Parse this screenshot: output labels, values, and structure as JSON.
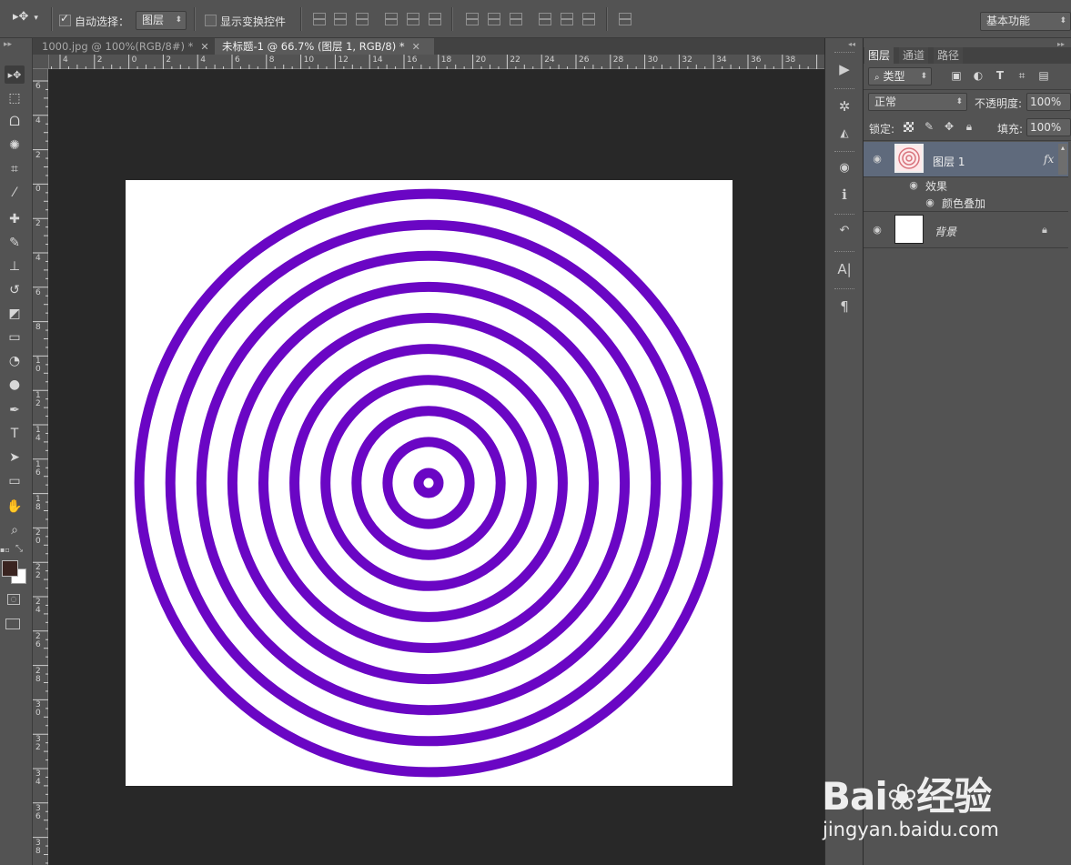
{
  "options_bar": {
    "auto_select_label": "自动选择：",
    "auto_select_checked": true,
    "auto_select_target": "图层",
    "show_transform_label": "显示变换控件",
    "show_transform_checked": false,
    "workspace": "基本功能"
  },
  "document_tabs": [
    {
      "title": "1000.jpg @ 100%(RGB/8#) *",
      "active": false
    },
    {
      "title": "未标题-1 @ 66.7% (图层 1, RGB/8) *",
      "active": true
    }
  ],
  "tools": [
    {
      "icon": "move-tool-icon",
      "glyph": "▸✥"
    },
    {
      "icon": "marquee-tool-icon",
      "glyph": "⬚"
    },
    {
      "icon": "lasso-tool-icon",
      "glyph": "ᗝ"
    },
    {
      "icon": "magic-wand-tool-icon",
      "glyph": "✺"
    },
    {
      "icon": "crop-tool-icon",
      "glyph": "⌗"
    },
    {
      "icon": "eyedropper-tool-icon",
      "glyph": "⁄"
    },
    {
      "icon": "healing-brush-tool-icon",
      "glyph": "✚"
    },
    {
      "icon": "brush-tool-icon",
      "glyph": "✎"
    },
    {
      "icon": "clone-stamp-tool-icon",
      "glyph": "⊥"
    },
    {
      "icon": "history-brush-tool-icon",
      "glyph": "↺"
    },
    {
      "icon": "eraser-tool-icon",
      "glyph": "◩"
    },
    {
      "icon": "gradient-tool-icon",
      "glyph": "▭"
    },
    {
      "icon": "blur-tool-icon",
      "glyph": "◔"
    },
    {
      "icon": "dodge-tool-icon",
      "glyph": "●"
    },
    {
      "icon": "pen-tool-icon",
      "glyph": "✒"
    },
    {
      "icon": "type-tool-icon",
      "glyph": "T"
    },
    {
      "icon": "path-selection-tool-icon",
      "glyph": "➤"
    },
    {
      "icon": "rectangle-tool-icon",
      "glyph": "▭"
    },
    {
      "icon": "hand-tool-icon",
      "glyph": "✋"
    },
    {
      "icon": "zoom-tool-icon",
      "glyph": "⌕"
    }
  ],
  "ruler": {
    "h_labels": [
      "4",
      "2",
      "0",
      "2",
      "4",
      "6",
      "8",
      "10",
      "12",
      "14",
      "16",
      "18",
      "20",
      "22",
      "24",
      "26",
      "28",
      "30",
      "32",
      "34",
      "36",
      "38"
    ],
    "v_labels": [
      "6",
      "4",
      "2",
      "0",
      "2",
      "4",
      "6",
      "8",
      "10",
      "12",
      "14",
      "16",
      "18",
      "20",
      "22",
      "24",
      "26",
      "28",
      "30",
      "32",
      "34",
      "36",
      "38"
    ]
  },
  "colors": {
    "foreground": "#3a2420",
    "background": "#ffffff",
    "ring": "#6a06c4",
    "canvas": "#ffffff"
  },
  "artwork": {
    "ring_count": 10,
    "description_icon": "concentric-rings"
  },
  "panel": {
    "tabs": [
      "图层",
      "通道",
      "路径"
    ],
    "active_tab": "图层",
    "filter_label": "类型",
    "blend_mode": "正常",
    "opacity_label": "不透明度:",
    "opacity_value": "100%",
    "lock_label": "锁定:",
    "fill_label": "填充:",
    "fill_value": "100%",
    "layers": [
      {
        "name": "图层 1",
        "selected": true,
        "fx": "fx",
        "effects_label": "效果",
        "effects": [
          "颜色叠加"
        ]
      },
      {
        "name": "背景",
        "selected": false,
        "locked": true
      }
    ]
  },
  "watermark": {
    "brand": "Bai",
    "brand_suffix": "经验",
    "url": "jingyan.baidu.com"
  }
}
